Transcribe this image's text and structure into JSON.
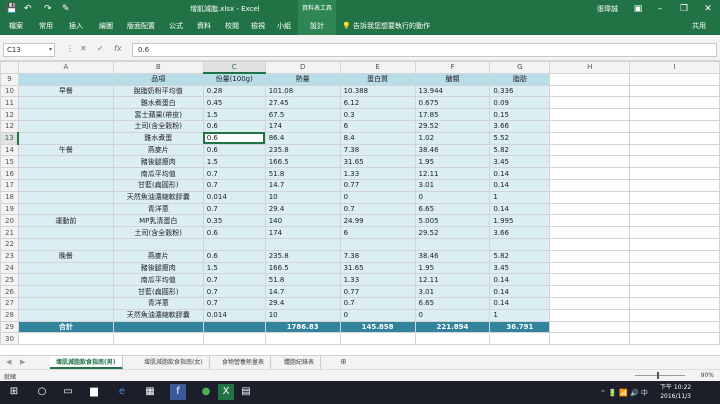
{
  "titlebar": {
    "title": "增肌減脂.xlsx - Excel",
    "context_group": "資料表工具",
    "user": "張瑋誠",
    "quick_access": [
      "💾",
      "↶",
      "↷",
      "✎"
    ]
  },
  "ribbon": {
    "tabs": [
      "檔案",
      "常用",
      "插入",
      "繪圖",
      "版面配置",
      "公式",
      "資料",
      "校閱",
      "檢視",
      "小組",
      "設計"
    ],
    "tell_me": "告訴我您想要執行的動作",
    "share": "共用"
  },
  "formula_bar": {
    "name_box": "C13",
    "formula": "0.6",
    "fx": "fx"
  },
  "columns": [
    "A",
    "B",
    "C",
    "D",
    "E",
    "F",
    "G",
    "H",
    "I"
  ],
  "header_row": {
    "row": "9",
    "B": "品項",
    "C": "份量(100g)",
    "D": "熱量",
    "E": "蛋白質",
    "F": "醣類",
    "G": "脂肪"
  },
  "rows": [
    {
      "n": "10",
      "A": "早餐",
      "B": "脫脂奶粉平均值",
      "C": "0.28",
      "D": "101.08",
      "E": "10.388",
      "F": "13.944",
      "G": "0.336"
    },
    {
      "n": "11",
      "A": "",
      "B": "雞水煮蛋白",
      "C": "0.45",
      "D": "27.45",
      "E": "6.12",
      "F": "0.675",
      "G": "0.09"
    },
    {
      "n": "12",
      "A": "",
      "B": "富士蘋果(帶皮)",
      "C": "1.5",
      "D": "67.5",
      "E": "0.3",
      "F": "17.85",
      "G": "0.15"
    },
    {
      "n": "12",
      "A": "",
      "B": "土司(含全穀粉)",
      "C": "0.6",
      "D": "174",
      "E": "6",
      "F": "29.52",
      "G": "3.66"
    },
    {
      "n": "13",
      "A": "",
      "B": "雞水煮蛋",
      "C": "0.6",
      "D": "86.4",
      "E": "8.4",
      "F": "1.02",
      "G": "5.52"
    },
    {
      "n": "14",
      "A": "午餐",
      "B": "燕麥片",
      "C": "0.6",
      "D": "235.8",
      "E": "7.38",
      "F": "38.46",
      "G": "5.82"
    },
    {
      "n": "15",
      "A": "",
      "B": "豬後腿瘦肉",
      "C": "1.5",
      "D": "166.5",
      "E": "31.65",
      "F": "1.95",
      "G": "3.45"
    },
    {
      "n": "16",
      "A": "",
      "B": "南瓜平均值",
      "C": "0.7",
      "D": "51.8",
      "E": "1.33",
      "F": "12.11",
      "G": "0.14"
    },
    {
      "n": "17",
      "A": "",
      "B": "甘藍(扁圓形)",
      "C": "0.7",
      "D": "14.7",
      "E": "0.77",
      "F": "3.01",
      "G": "0.14"
    },
    {
      "n": "18",
      "A": "",
      "B": "天然魚油濃縮軟膠囊",
      "C": "0.014",
      "D": "10",
      "E": "0",
      "F": "0",
      "G": "1"
    },
    {
      "n": "19",
      "A": "",
      "B": "青洋蔥",
      "C": "0.7",
      "D": "29.4",
      "E": "0.7",
      "F": "6.65",
      "G": "0.14"
    },
    {
      "n": "20",
      "A": "運動前",
      "B": "MP乳清蛋白",
      "C": "0.35",
      "D": "140",
      "E": "24.99",
      "F": "5.005",
      "G": "1.995"
    },
    {
      "n": "21",
      "A": "",
      "B": "土司(含全穀粉)",
      "C": "0.6",
      "D": "174",
      "E": "6",
      "F": "29.52",
      "G": "3.66"
    },
    {
      "n": "22",
      "A": "",
      "B": "",
      "C": "",
      "D": "",
      "E": "",
      "F": "",
      "G": ""
    },
    {
      "n": "23",
      "A": "晚餐",
      "B": "燕麥片",
      "C": "0.6",
      "D": "235.8",
      "E": "7.38",
      "F": "38.46",
      "G": "5.82"
    },
    {
      "n": "24",
      "A": "",
      "B": "豬後腿瘦肉",
      "C": "1.5",
      "D": "166.5",
      "E": "31.65",
      "F": "1.95",
      "G": "3.45"
    },
    {
      "n": "25",
      "A": "",
      "B": "南瓜平均值",
      "C": "0.7",
      "D": "51.8",
      "E": "1.33",
      "F": "12.11",
      "G": "0.14"
    },
    {
      "n": "26",
      "A": "",
      "B": "甘藍(扁圓形)",
      "C": "0.7",
      "D": "14.7",
      "E": "0.77",
      "F": "3.01",
      "G": "0.14"
    },
    {
      "n": "27",
      "A": "",
      "B": "青洋蔥",
      "C": "0.7",
      "D": "29.4",
      "E": "0.7",
      "F": "6.65",
      "G": "0.14"
    },
    {
      "n": "28",
      "A": "",
      "B": "天然魚油濃縮軟膠囊",
      "C": "0.014",
      "D": "10",
      "E": "0",
      "F": "0",
      "G": "1"
    }
  ],
  "total_row": {
    "n": "29",
    "A": "合計",
    "D": "1786.83",
    "E": "145.858",
    "F": "221.894",
    "G": "36.791"
  },
  "partial_row": {
    "n": "30"
  },
  "sheet_tabs": [
    "增肌減脂飲食指南(男)",
    "增肌減脂飲食指南(女)",
    "食物營養熱量表",
    "體脂紀錄表"
  ],
  "status": {
    "ready": "就緒",
    "zoom": "90%"
  },
  "clock": {
    "time": "下午 10:22",
    "date": "2016/11/3"
  },
  "colors": {
    "excel_green": "#217346",
    "row_light": "#dbeef4",
    "row_header": "#b7dde8",
    "total": "#31849b"
  }
}
